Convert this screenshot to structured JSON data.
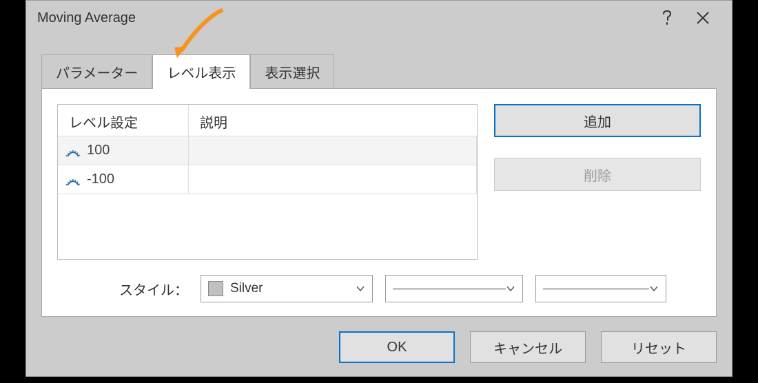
{
  "titlebar": {
    "title": "Moving Average"
  },
  "tabs": [
    {
      "label": "パラメーター"
    },
    {
      "label": "レベル表示"
    },
    {
      "label": "表示選択"
    }
  ],
  "table": {
    "headers": {
      "level": "レベル設定",
      "desc": "説明"
    },
    "rows": [
      {
        "level": "100",
        "desc": ""
      },
      {
        "level": "-100",
        "desc": ""
      }
    ]
  },
  "buttons": {
    "add": "追加",
    "delete": "削除",
    "ok": "OK",
    "cancel": "キャンセル",
    "reset": "リセット"
  },
  "style": {
    "label": "スタイル：",
    "color_name": "Silver"
  }
}
